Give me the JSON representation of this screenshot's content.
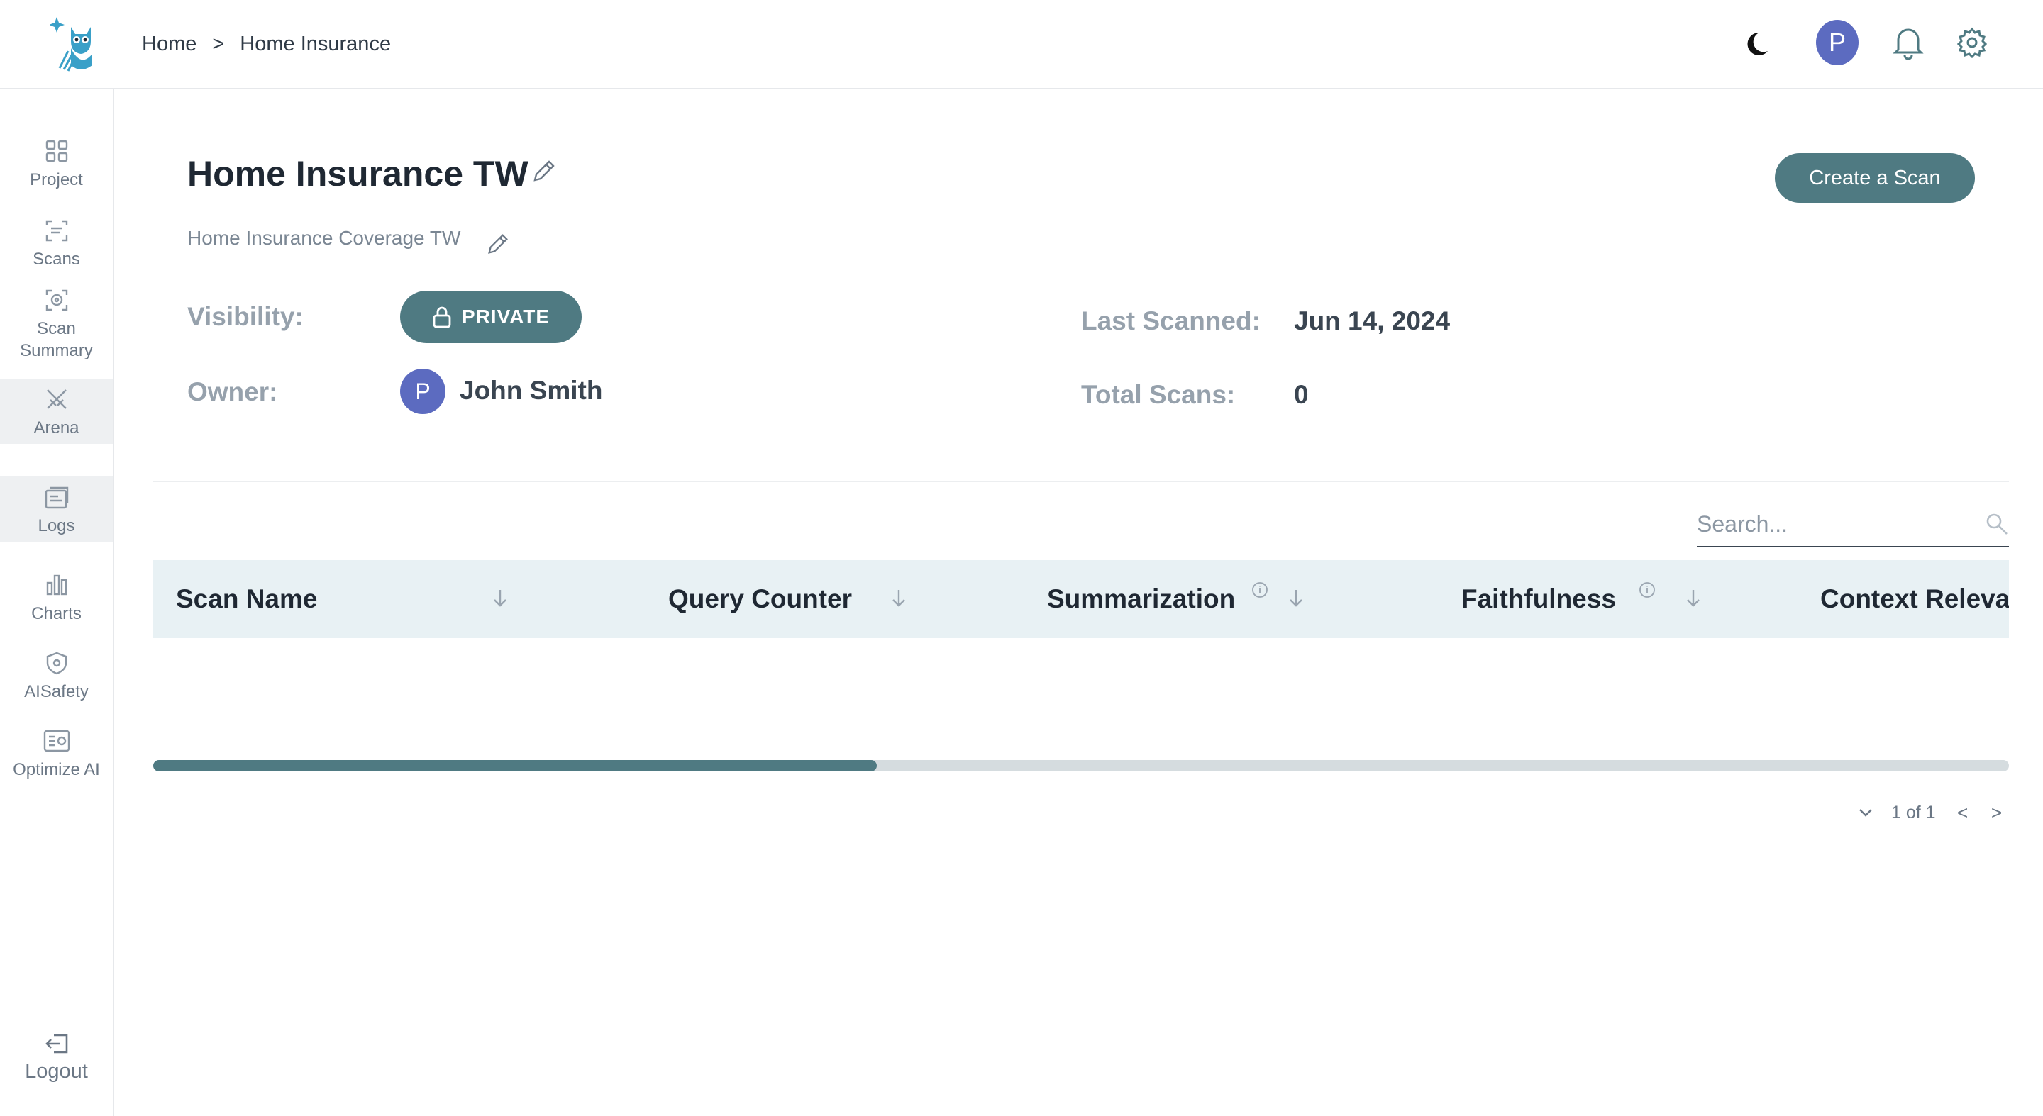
{
  "header": {
    "breadcrumb": [
      "Home",
      "Home Insurance"
    ],
    "breadcrumb_separator": ">",
    "avatar_initial": "P"
  },
  "sidebar": {
    "items": [
      {
        "label": "Project",
        "icon": "grid-icon"
      },
      {
        "label": "Scans",
        "icon": "scan-icon"
      },
      {
        "label": "Scan Summary",
        "icon": "scan-summary-icon"
      },
      {
        "label": "Arena",
        "icon": "swords-icon"
      },
      {
        "label": "Logs",
        "icon": "logs-icon"
      },
      {
        "label": "Charts",
        "icon": "bar-chart-icon"
      },
      {
        "label": "AISafety",
        "icon": "shield-icon"
      },
      {
        "label": "Optimize AI",
        "icon": "optimize-icon"
      }
    ],
    "logout_label": "Logout"
  },
  "project": {
    "title": "Home Insurance TW",
    "subtitle": "Home Insurance Coverage TW",
    "create_button": "Create a Scan",
    "visibility_label": "Visibility:",
    "visibility_value": "PRIVATE",
    "owner_label": "Owner:",
    "owner_initial": "P",
    "owner_name": "John Smith",
    "last_scanned_label": "Last Scanned:",
    "last_scanned_value": "Jun 14, 2024",
    "total_scans_label": "Total Scans:",
    "total_scans_value": "0"
  },
  "search": {
    "placeholder": "Search..."
  },
  "table": {
    "columns": [
      {
        "label": "Scan Name",
        "info": false
      },
      {
        "label": "Query Counter",
        "info": false
      },
      {
        "label": "Summarization",
        "info": true
      },
      {
        "label": "Faithfulness",
        "info": true
      },
      {
        "label": "Context Releva",
        "info": false
      }
    ],
    "scroll_fraction": 0.39
  },
  "pagination": {
    "page_text": "1 of 1",
    "prev": "<",
    "next": ">"
  },
  "colors": {
    "accent": "#4f7a82",
    "avatar": "#5c6bc0",
    "table_header": "#e8f1f4"
  }
}
